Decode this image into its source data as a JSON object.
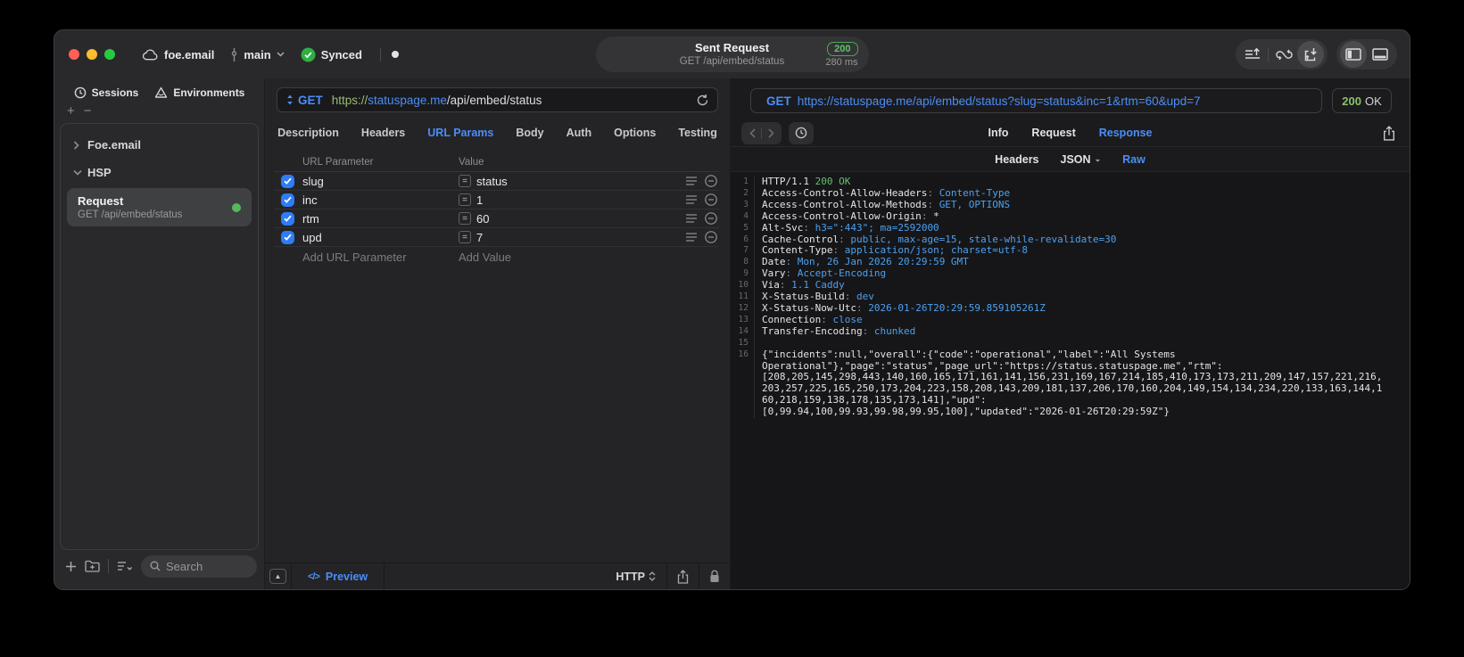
{
  "titlebar": {
    "project": "foe.email",
    "branch": "main",
    "sync_status": "Synced",
    "title": "Sent Request",
    "subtitle": "GET /api/embed/status",
    "status_code": "200",
    "duration": "280 ms"
  },
  "sidebar": {
    "tabs": [
      {
        "label": "Sessions"
      },
      {
        "label": "Environments"
      }
    ],
    "add_label": "+",
    "remove_label": "−",
    "tree": {
      "group_collapsed": "Foe.email",
      "group_expanded": "HSP",
      "request": {
        "title": "Request",
        "subtitle": "GET /api/embed/status"
      }
    },
    "search_placeholder": "Search"
  },
  "request_editor": {
    "method": "GET",
    "url_scheme": "https://",
    "url_host": "statuspage.me",
    "url_path": "/api/embed/status",
    "tabs": [
      {
        "label": "Description",
        "active": false
      },
      {
        "label": "Headers",
        "active": false
      },
      {
        "label": "URL Params",
        "active": true
      },
      {
        "label": "Body",
        "active": false
      },
      {
        "label": "Auth",
        "active": false
      },
      {
        "label": "Options",
        "active": false
      },
      {
        "label": "Testing",
        "active": false
      }
    ],
    "table": {
      "col_param": "URL Parameter",
      "col_value": "Value",
      "rows": [
        {
          "name": "slug",
          "value": "status",
          "checked": true
        },
        {
          "name": "inc",
          "value": "1",
          "checked": true
        },
        {
          "name": "rtm",
          "value": "60",
          "checked": true
        },
        {
          "name": "upd",
          "value": "7",
          "checked": true
        }
      ],
      "add_name_placeholder": "Add URL Parameter",
      "add_value_placeholder": "Add Value"
    },
    "footer": {
      "preview_label": "Preview",
      "code_glyph": "</>",
      "protocol": "HTTP"
    }
  },
  "response_panel": {
    "method": "GET",
    "url": "https://statuspage.me/api/embed/status?slug=status&inc=1&rtm=60&upd=7",
    "status_code": "200",
    "status_text": "OK",
    "tabs": [
      {
        "label": "Info",
        "active": false
      },
      {
        "label": "Request",
        "active": false
      },
      {
        "label": "Response",
        "active": true
      }
    ],
    "view_tabs": [
      {
        "label": "Headers",
        "active": false,
        "chevron": false
      },
      {
        "label": "JSON",
        "active": false,
        "chevron": true
      },
      {
        "label": "Raw",
        "active": true,
        "chevron": false
      }
    ],
    "body_lines": [
      {
        "n": "1",
        "parts": [
          {
            "t": "HTTP/1.1 ",
            "c": "w"
          },
          {
            "t": "200 OK",
            "c": "g"
          }
        ]
      },
      {
        "n": "2",
        "parts": [
          {
            "t": "Access-Control-Allow-Headers",
            "c": "w"
          },
          {
            "t": ": ",
            "c": "d"
          },
          {
            "t": "Content-Type",
            "c": "b"
          }
        ]
      },
      {
        "n": "3",
        "parts": [
          {
            "t": "Access-Control-Allow-Methods",
            "c": "w"
          },
          {
            "t": ": ",
            "c": "d"
          },
          {
            "t": "GET, OPTIONS",
            "c": "b"
          }
        ]
      },
      {
        "n": "4",
        "parts": [
          {
            "t": "Access-Control-Allow-Origin",
            "c": "w"
          },
          {
            "t": ": ",
            "c": "d"
          },
          {
            "t": "*",
            "c": "w"
          }
        ]
      },
      {
        "n": "5",
        "parts": [
          {
            "t": "Alt-Svc",
            "c": "w"
          },
          {
            "t": ": ",
            "c": "d"
          },
          {
            "t": "h3=\":443\"; ma=2592000",
            "c": "b"
          }
        ]
      },
      {
        "n": "6",
        "parts": [
          {
            "t": "Cache-Control",
            "c": "w"
          },
          {
            "t": ": ",
            "c": "d"
          },
          {
            "t": "public, max-age=15, stale-while-revalidate=30",
            "c": "b"
          }
        ]
      },
      {
        "n": "7",
        "parts": [
          {
            "t": "Content-Type",
            "c": "w"
          },
          {
            "t": ": ",
            "c": "d"
          },
          {
            "t": "application/json; charset=utf-8",
            "c": "b"
          }
        ]
      },
      {
        "n": "8",
        "parts": [
          {
            "t": "Date",
            "c": "w"
          },
          {
            "t": ": ",
            "c": "d"
          },
          {
            "t": "Mon, 26 Jan 2026 20:29:59 GMT",
            "c": "b"
          }
        ]
      },
      {
        "n": "9",
        "parts": [
          {
            "t": "Vary",
            "c": "w"
          },
          {
            "t": ": ",
            "c": "d"
          },
          {
            "t": "Accept-Encoding",
            "c": "b"
          }
        ]
      },
      {
        "n": "10",
        "parts": [
          {
            "t": "Via",
            "c": "w"
          },
          {
            "t": ": ",
            "c": "d"
          },
          {
            "t": "1.1 Caddy",
            "c": "b"
          }
        ]
      },
      {
        "n": "11",
        "parts": [
          {
            "t": "X-Status-Build",
            "c": "w"
          },
          {
            "t": ": ",
            "c": "d"
          },
          {
            "t": "dev",
            "c": "b"
          }
        ]
      },
      {
        "n": "12",
        "parts": [
          {
            "t": "X-Status-Now-Utc",
            "c": "w"
          },
          {
            "t": ": ",
            "c": "d"
          },
          {
            "t": "2026-01-26T20:29:59.859105261Z",
            "c": "b"
          }
        ]
      },
      {
        "n": "13",
        "parts": [
          {
            "t": "Connection",
            "c": "w"
          },
          {
            "t": ": ",
            "c": "d"
          },
          {
            "t": "close",
            "c": "b"
          }
        ]
      },
      {
        "n": "14",
        "parts": [
          {
            "t": "Transfer-Encoding",
            "c": "w"
          },
          {
            "t": ": ",
            "c": "d"
          },
          {
            "t": "chunked",
            "c": "b"
          }
        ]
      },
      {
        "n": "15",
        "parts": []
      },
      {
        "n": "16",
        "parts": [
          {
            "t": "{\"incidents\":null,\"overall\":{\"code\":\"operational\",\"label\":\"All Systems",
            "c": "w"
          }
        ]
      },
      {
        "n": "",
        "parts": [
          {
            "t": "Operational\"},\"page\":\"status\",\"page_url\":\"https://status.statuspage.me\",\"rtm\":",
            "c": "w"
          }
        ]
      },
      {
        "n": "",
        "parts": [
          {
            "t": "[208,205,145,298,443,140,160,165,171,161,141,156,231,169,167,214,185,410,173,173,211,209,147,157,221,216,",
            "c": "w"
          }
        ]
      },
      {
        "n": "",
        "parts": [
          {
            "t": "203,257,225,165,250,173,204,223,158,208,143,209,181,137,206,170,160,204,149,154,134,234,220,133,163,144,1",
            "c": "w"
          }
        ]
      },
      {
        "n": "",
        "parts": [
          {
            "t": "60,218,159,138,178,135,173,141],\"upd\":",
            "c": "w"
          }
        ]
      },
      {
        "n": "",
        "parts": [
          {
            "t": "[0,99.94,100,99.93,99.98,99.95,100],\"updated\":\"2026-01-26T20:29:59Z\"}",
            "c": "w"
          }
        ]
      }
    ]
  },
  "colors": {
    "accent_blue": "#4c8df6",
    "status_green": "#5fc36a",
    "scheme_green": "#9cb977",
    "checkbox_blue": "#2f7cf7",
    "value_blue": "#4da0f0"
  }
}
